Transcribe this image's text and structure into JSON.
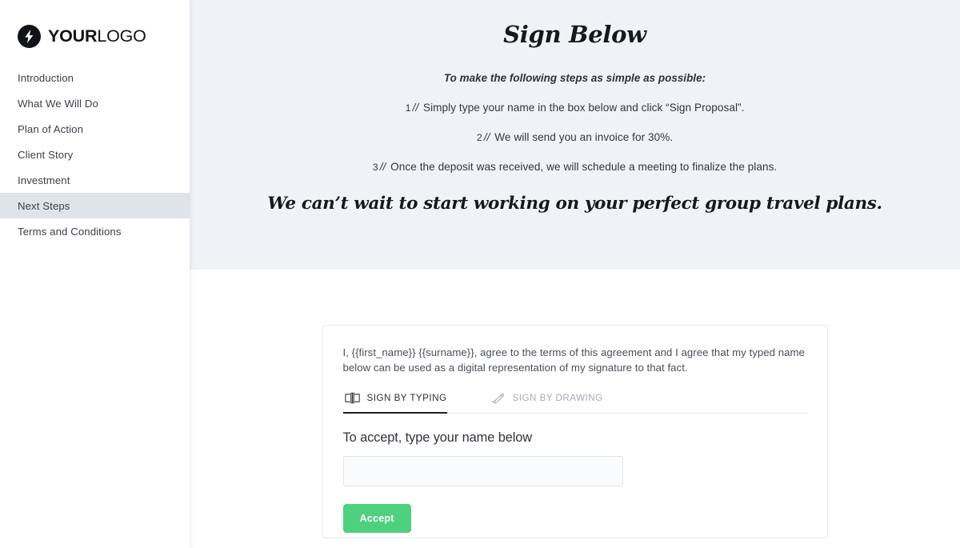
{
  "sidebar": {
    "logo": {
      "icon": "lightning-bolt-icon",
      "bold_part": "YOUR",
      "light_part": "LOGO"
    },
    "items": [
      {
        "label": "Introduction",
        "active": false
      },
      {
        "label": "What We Will Do",
        "active": false
      },
      {
        "label": "Plan of Action",
        "active": false
      },
      {
        "label": "Client Story",
        "active": false
      },
      {
        "label": "Investment",
        "active": false
      },
      {
        "label": "Next Steps",
        "active": true
      },
      {
        "label": "Terms and Conditions",
        "active": false
      }
    ]
  },
  "hero": {
    "title": "Sign Below",
    "subtitle": "To make the following steps as simple as possible:",
    "steps": [
      {
        "number": "1",
        "separator": "//",
        "text": "Simply type your name in the box below and click “Sign Proposal”."
      },
      {
        "number": "2",
        "separator": "//",
        "text": "We will send you an invoice for 30%."
      },
      {
        "number": "3",
        "separator": "//",
        "text": "Once the deposit was received, we will schedule a meeting to finalize the plans."
      }
    ],
    "tagline": "We can’t wait to start working on your perfect group travel plans."
  },
  "sign_card": {
    "agreement_text": "I, {{first_name}} {{surname}}, agree to the terms of this agreement and I agree that my typed name below can be used as a digital representation of my signature to that fact.",
    "tabs": [
      {
        "label": "SIGN BY TYPING",
        "icon": "keyboard-typing-icon",
        "active": true
      },
      {
        "label": "SIGN BY DRAWING",
        "icon": "pen-drawing-icon",
        "active": false
      }
    ],
    "input_label": "To accept, type your name below",
    "input_value": "",
    "input_placeholder": "",
    "accept_button": "Accept"
  },
  "colors": {
    "hero_background": "#f1f2f7",
    "sidebar_active": "#dfe3ea",
    "accept_green": "#4ed07f",
    "text_dark": "#16181c",
    "tab_active_underline": "#1d2025"
  }
}
